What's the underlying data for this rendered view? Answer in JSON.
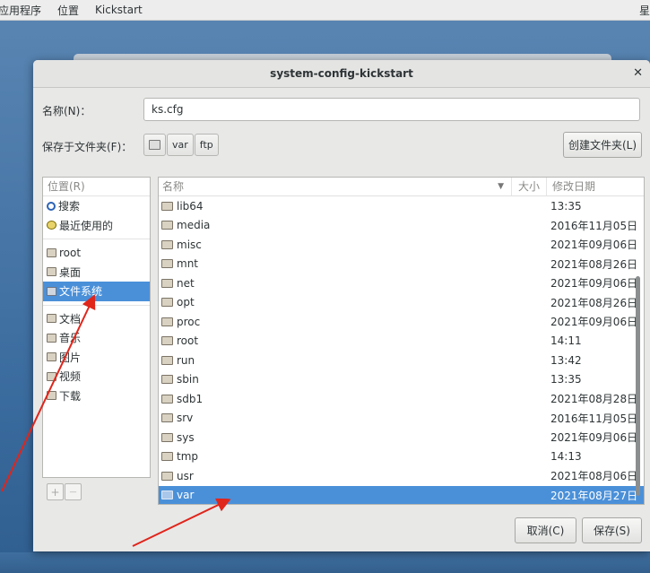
{
  "topbar": {
    "applications": "应用程序",
    "places": "位置",
    "app_name": "Kickstart",
    "clock_partial": "星"
  },
  "dialog": {
    "title": "system-config-kickstart",
    "name_label": "名称(N)：",
    "name_value": "ks.cfg",
    "folder_label": "保存于文件夹(F)：",
    "path_buttons": [
      "var",
      "ftp"
    ],
    "create_folder_label": "创建文件夹(L)",
    "cancel_label": "取消(C)",
    "save_label": "保存(S)"
  },
  "sidebar": {
    "header": "位置(R)",
    "group1": [
      {
        "label": "搜索",
        "icon": "search-icon"
      },
      {
        "label": "最近使用的",
        "icon": "recent-icon"
      }
    ],
    "group2": [
      {
        "label": "root",
        "icon": "home-folder-icon",
        "selected": false
      },
      {
        "label": "桌面",
        "icon": "desktop-folder-icon",
        "selected": false
      },
      {
        "label": "文件系统",
        "icon": "filesystem-icon",
        "selected": true
      }
    ],
    "group3": [
      {
        "label": "文档",
        "icon": "documents-folder-icon"
      },
      {
        "label": "音乐",
        "icon": "music-folder-icon"
      },
      {
        "label": "图片",
        "icon": "pictures-folder-icon"
      },
      {
        "label": "视频",
        "icon": "videos-folder-icon"
      },
      {
        "label": "下载",
        "icon": "downloads-folder-icon"
      }
    ],
    "add_button": "+",
    "remove_button": "—"
  },
  "filelist": {
    "columns": {
      "name": "名称",
      "size": "大小",
      "modified": "修改日期"
    },
    "rows": [
      {
        "name": "lib64",
        "date": "13:35"
      },
      {
        "name": "media",
        "date": "2016年11月05日"
      },
      {
        "name": "misc",
        "date": "2021年09月06日"
      },
      {
        "name": "mnt",
        "date": "2021年08月26日"
      },
      {
        "name": "net",
        "date": "2021年09月06日"
      },
      {
        "name": "opt",
        "date": "2021年08月26日"
      },
      {
        "name": "proc",
        "date": "2021年09月06日"
      },
      {
        "name": "root",
        "date": "14:11"
      },
      {
        "name": "run",
        "date": "13:42"
      },
      {
        "name": "sbin",
        "date": "13:35"
      },
      {
        "name": "sdb1",
        "date": "2021年08月28日"
      },
      {
        "name": "srv",
        "date": "2016年11月05日"
      },
      {
        "name": "sys",
        "date": "2021年09月06日"
      },
      {
        "name": "tmp",
        "date": "14:13"
      },
      {
        "name": "usr",
        "date": "2021年08月06日"
      },
      {
        "name": "var",
        "date": "2021年08月27日",
        "selected": true
      }
    ]
  },
  "colors": {
    "selection": "#4a90d9",
    "annotation_arrow": "#e0251b"
  }
}
